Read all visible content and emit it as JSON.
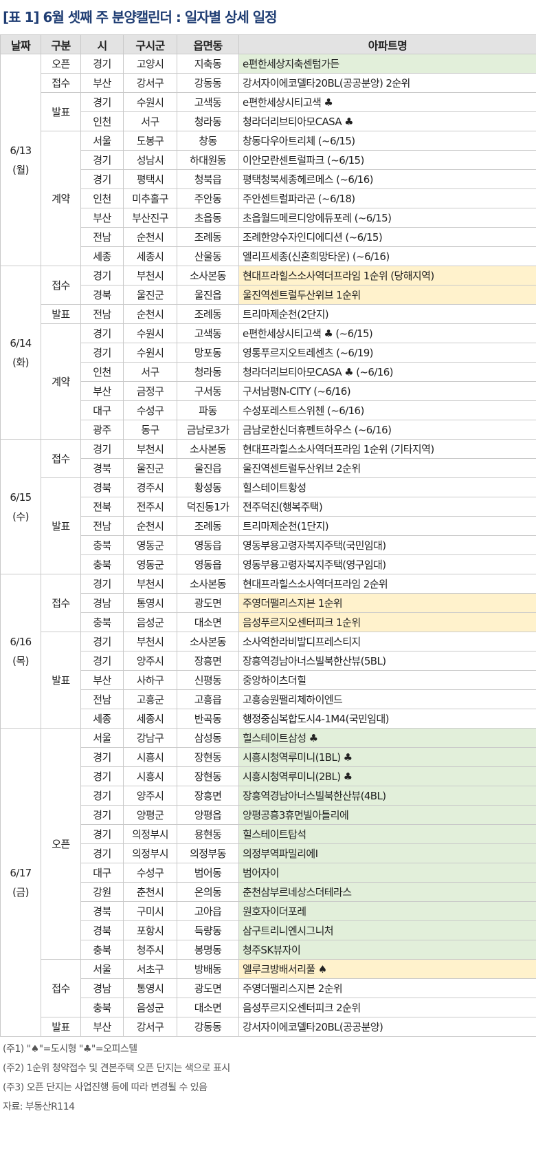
{
  "title": "[표 1] 6월 셋째 주 분양캘린더 : 일자별 상세 일정",
  "headers": [
    "날짜",
    "구분",
    "시",
    "구시군",
    "읍면동",
    "아파트명"
  ],
  "groups": [
    {
      "date": "6/13",
      "day": "(월)",
      "sections": [
        {
          "type": "오픈",
          "rows": [
            {
              "si": "경기",
              "gu": "고양시",
              "dong": "지축동",
              "apt": "e편한세상지축센텀가든",
              "hl": "green"
            }
          ]
        },
        {
          "type": "접수",
          "rows": [
            {
              "si": "부산",
              "gu": "강서구",
              "dong": "강동동",
              "apt": "강서자이에코델타20BL(공공분양) 2순위",
              "hl": ""
            }
          ]
        },
        {
          "type": "발표",
          "rows": [
            {
              "si": "경기",
              "gu": "수원시",
              "dong": "고색동",
              "apt": "e편한세상시티고색 ♣",
              "hl": ""
            },
            {
              "si": "인천",
              "gu": "서구",
              "dong": "청라동",
              "apt": "청라더리브티아모CASA ♣",
              "hl": ""
            }
          ]
        },
        {
          "type": "계약",
          "rows": [
            {
              "si": "서울",
              "gu": "도봉구",
              "dong": "창동",
              "apt": "창동다우아트리체 (~6/15)",
              "hl": ""
            },
            {
              "si": "경기",
              "gu": "성남시",
              "dong": "하대원동",
              "apt": "이안모란센트럴파크 (~6/15)",
              "hl": ""
            },
            {
              "si": "경기",
              "gu": "평택시",
              "dong": "청북읍",
              "apt": "평택청북세종헤르메스 (~6/16)",
              "hl": ""
            },
            {
              "si": "인천",
              "gu": "미추홀구",
              "dong": "주안동",
              "apt": "주안센트럴파라곤 (~6/18)",
              "hl": ""
            },
            {
              "si": "부산",
              "gu": "부산진구",
              "dong": "초읍동",
              "apt": "초읍월드메르디앙에듀포레 (~6/15)",
              "hl": ""
            },
            {
              "si": "전남",
              "gu": "순천시",
              "dong": "조례동",
              "apt": "조례한양수자인디에디션 (~6/15)",
              "hl": ""
            },
            {
              "si": "세종",
              "gu": "세종시",
              "dong": "산울동",
              "apt": "엘리프세종(신혼희망타운) (~6/16)",
              "hl": ""
            }
          ]
        }
      ]
    },
    {
      "date": "6/14",
      "day": "(화)",
      "sections": [
        {
          "type": "접수",
          "rows": [
            {
              "si": "경기",
              "gu": "부천시",
              "dong": "소사본동",
              "apt": "현대프라힐스소사역더프라임 1순위 (당해지역)",
              "hl": "yellow"
            },
            {
              "si": "경북",
              "gu": "울진군",
              "dong": "울진읍",
              "apt": "울진역센트럴두산위브 1순위",
              "hl": "yellow"
            }
          ]
        },
        {
          "type": "발표",
          "rows": [
            {
              "si": "전남",
              "gu": "순천시",
              "dong": "조례동",
              "apt": "트리마제순천(2단지)",
              "hl": ""
            }
          ]
        },
        {
          "type": "계약",
          "rows": [
            {
              "si": "경기",
              "gu": "수원시",
              "dong": "고색동",
              "apt": "e편한세상시티고색 ♣ (~6/15)",
              "hl": ""
            },
            {
              "si": "경기",
              "gu": "수원시",
              "dong": "망포동",
              "apt": "영통푸르지오트레센츠 (~6/19)",
              "hl": ""
            },
            {
              "si": "인천",
              "gu": "서구",
              "dong": "청라동",
              "apt": "청라더리브티아모CASA ♣ (~6/16)",
              "hl": ""
            },
            {
              "si": "부산",
              "gu": "금정구",
              "dong": "구서동",
              "apt": "구서남평N-CITY (~6/16)",
              "hl": ""
            },
            {
              "si": "대구",
              "gu": "수성구",
              "dong": "파동",
              "apt": "수성포레스트스위첸 (~6/16)",
              "hl": ""
            },
            {
              "si": "광주",
              "gu": "동구",
              "dong": "금남로3가",
              "apt": "금남로한신더휴펜트하우스 (~6/16)",
              "hl": ""
            }
          ]
        }
      ]
    },
    {
      "date": "6/15",
      "day": "(수)",
      "sections": [
        {
          "type": "접수",
          "rows": [
            {
              "si": "경기",
              "gu": "부천시",
              "dong": "소사본동",
              "apt": "현대프라힐스소사역더프라임 1순위 (기타지역)",
              "hl": ""
            },
            {
              "si": "경북",
              "gu": "울진군",
              "dong": "울진읍",
              "apt": "울진역센트럴두산위브 2순위",
              "hl": ""
            }
          ]
        },
        {
          "type": "발표",
          "rows": [
            {
              "si": "경북",
              "gu": "경주시",
              "dong": "황성동",
              "apt": "힐스테이트황성",
              "hl": ""
            },
            {
              "si": "전북",
              "gu": "전주시",
              "dong": "덕진동1가",
              "apt": "전주덕진(행복주택)",
              "hl": ""
            },
            {
              "si": "전남",
              "gu": "순천시",
              "dong": "조례동",
              "apt": "트리마제순천(1단지)",
              "hl": ""
            },
            {
              "si": "충북",
              "gu": "영동군",
              "dong": "영동읍",
              "apt": "영동부용고령자복지주택(국민임대)",
              "hl": ""
            },
            {
              "si": "충북",
              "gu": "영동군",
              "dong": "영동읍",
              "apt": "영동부용고령자복지주택(영구임대)",
              "hl": ""
            }
          ]
        }
      ]
    },
    {
      "date": "6/16",
      "day": "(목)",
      "sections": [
        {
          "type": "접수",
          "rows": [
            {
              "si": "경기",
              "gu": "부천시",
              "dong": "소사본동",
              "apt": "현대프라힐스소사역더프라임 2순위",
              "hl": ""
            },
            {
              "si": "경남",
              "gu": "통영시",
              "dong": "광도면",
              "apt": "주영더팰리스지븐 1순위",
              "hl": "yellow"
            },
            {
              "si": "충북",
              "gu": "음성군",
              "dong": "대소면",
              "apt": "음성푸르지오센터피크 1순위",
              "hl": "yellow"
            }
          ]
        },
        {
          "type": "발표",
          "rows": [
            {
              "si": "경기",
              "gu": "부천시",
              "dong": "소사본동",
              "apt": "소사역한라비발디프레스티지",
              "hl": ""
            },
            {
              "si": "경기",
              "gu": "양주시",
              "dong": "장흥면",
              "apt": "장흥역경남아너스빌북한산뷰(5BL)",
              "hl": ""
            },
            {
              "si": "부산",
              "gu": "사하구",
              "dong": "신평동",
              "apt": "중앙하이츠더힐",
              "hl": ""
            },
            {
              "si": "전남",
              "gu": "고흥군",
              "dong": "고흥읍",
              "apt": "고흥승원팰리체하이엔드",
              "hl": ""
            },
            {
              "si": "세종",
              "gu": "세종시",
              "dong": "반곡동",
              "apt": "행정중심복합도시4-1M4(국민임대)",
              "hl": ""
            }
          ]
        }
      ]
    },
    {
      "date": "6/17",
      "day": "(금)",
      "sections": [
        {
          "type": "오픈",
          "rows": [
            {
              "si": "서울",
              "gu": "강남구",
              "dong": "삼성동",
              "apt": "힐스테이트삼성 ♣",
              "hl": "green"
            },
            {
              "si": "경기",
              "gu": "시흥시",
              "dong": "장현동",
              "apt": "시흥시청역루미니(1BL) ♣",
              "hl": "green"
            },
            {
              "si": "경기",
              "gu": "시흥시",
              "dong": "장현동",
              "apt": "시흥시청역루미니(2BL) ♣",
              "hl": "green"
            },
            {
              "si": "경기",
              "gu": "양주시",
              "dong": "장흥면",
              "apt": "장흥역경남아너스빌북한산뷰(4BL)",
              "hl": "green"
            },
            {
              "si": "경기",
              "gu": "양평군",
              "dong": "양평읍",
              "apt": "양평공흥3휴먼빌아틀리에",
              "hl": "green"
            },
            {
              "si": "경기",
              "gu": "의정부시",
              "dong": "용현동",
              "apt": "힐스테이트탑석",
              "hl": "green"
            },
            {
              "si": "경기",
              "gu": "의정부시",
              "dong": "의정부동",
              "apt": "의정부역파밀리에Ⅰ",
              "hl": "green"
            },
            {
              "si": "대구",
              "gu": "수성구",
              "dong": "범어동",
              "apt": "범어자이",
              "hl": "green"
            },
            {
              "si": "강원",
              "gu": "춘천시",
              "dong": "온의동",
              "apt": "춘천삼부르네상스더테라스",
              "hl": "green"
            },
            {
              "si": "경북",
              "gu": "구미시",
              "dong": "고아읍",
              "apt": "원호자이더포레",
              "hl": "green"
            },
            {
              "si": "경북",
              "gu": "포항시",
              "dong": "득량동",
              "apt": "삼구트리니엔시그니처",
              "hl": "green"
            },
            {
              "si": "충북",
              "gu": "청주시",
              "dong": "봉명동",
              "apt": "청주SK뷰자이",
              "hl": "green"
            }
          ]
        },
        {
          "type": "접수",
          "rows": [
            {
              "si": "서울",
              "gu": "서초구",
              "dong": "방배동",
              "apt": "엘루크방배서리풀 ♠",
              "hl": "yellow"
            },
            {
              "si": "경남",
              "gu": "통영시",
              "dong": "광도면",
              "apt": "주영더팰리스지븐 2순위",
              "hl": ""
            },
            {
              "si": "충북",
              "gu": "음성군",
              "dong": "대소면",
              "apt": "음성푸르지오센터피크 2순위",
              "hl": ""
            }
          ]
        },
        {
          "type": "발표",
          "rows": [
            {
              "si": "부산",
              "gu": "강서구",
              "dong": "강동동",
              "apt": "강서자이에코델타20BL(공공분양)",
              "hl": ""
            }
          ]
        }
      ]
    }
  ],
  "notes": [
    "(주1) \"♠\"=도시형 \"♣\"=오피스텔",
    "(주2)  1순위 청약접수 및 견본주택 오픈 단지는 색으로  표시",
    "(주3) 오픈 단지는 사업진행 등에 따라 변경될 수 있음",
    "자료: 부동산R114"
  ],
  "colors": {
    "title": "#1f3d73",
    "header_bg": "#e3e3e3",
    "open_highlight": "#e2efda",
    "first_round_highlight": "#fff2cc"
  }
}
